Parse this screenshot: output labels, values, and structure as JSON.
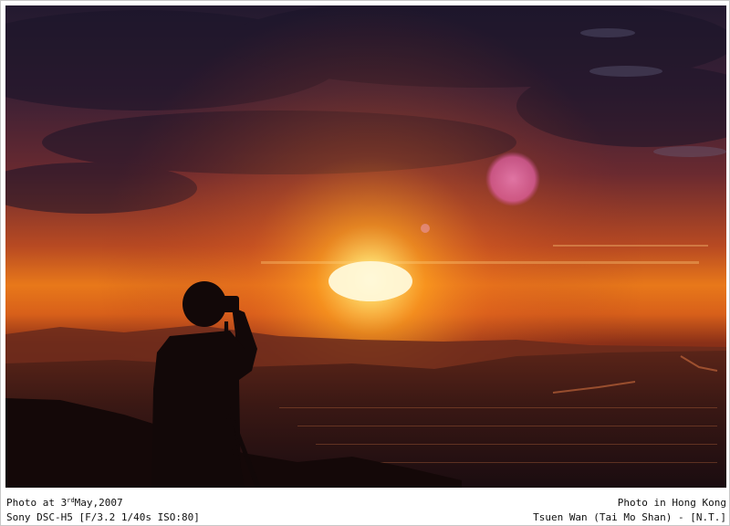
{
  "caption": {
    "left_line1_prefix": "Photo at 3",
    "left_line1_sup": "rd",
    "left_line1_suffix": "May,2007",
    "left_line2": "Sony DSC-H5 [F/3.2 1/40s ISO:80]",
    "right_line1": "Photo in Hong Kong",
    "right_line2": "Tsuen Wan (Tai Mo Shan) - [N.T.]"
  },
  "colors": {
    "sky_top": "#2a1a35",
    "sky_mid": "#8a2a2a",
    "horizon": "#ff8a10",
    "sun": "#fff4c0",
    "ground": "#1a0c10",
    "lens_flare": "#e070a8"
  }
}
